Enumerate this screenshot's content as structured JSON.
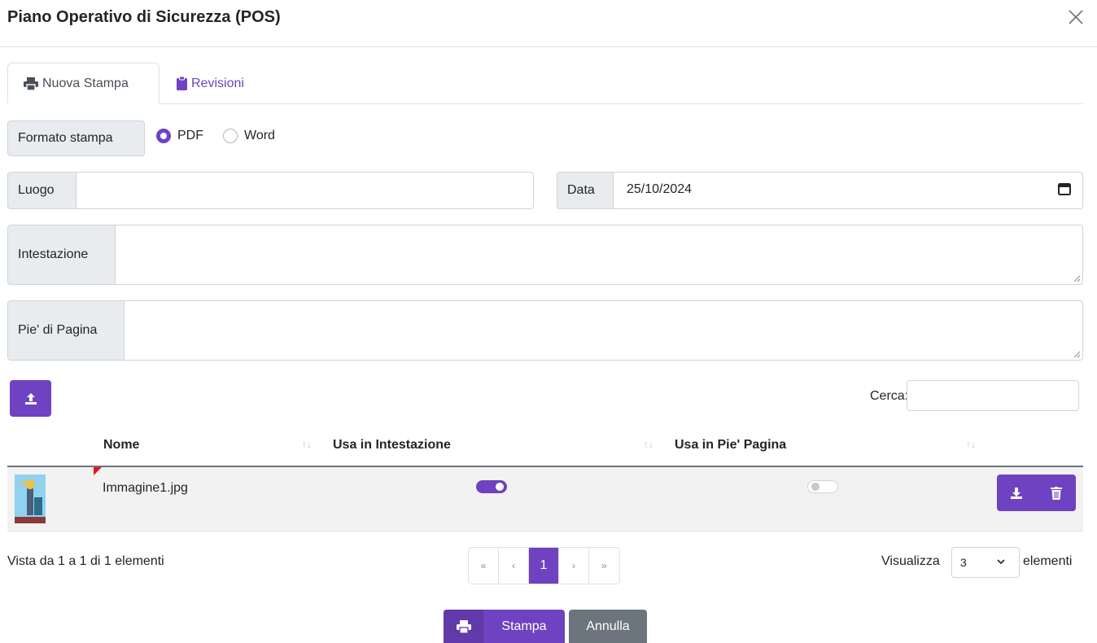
{
  "modal": {
    "title": "Piano Operativo di Sicurezza (POS)"
  },
  "tabs": [
    {
      "label": "Nuova Stampa",
      "icon": "print-icon",
      "active": true
    },
    {
      "label": "Revisioni",
      "icon": "clipboard-icon",
      "active": false
    }
  ],
  "form": {
    "format_label": "Formato stampa",
    "format_options": [
      {
        "label": "PDF",
        "checked": true
      },
      {
        "label": "Word",
        "checked": false
      }
    ],
    "place_label": "Luogo",
    "place_value": "",
    "date_label": "Data",
    "date_value": "25/10/2024",
    "header_label": "Intestazione",
    "header_value": "",
    "footer_label": "Pie' di Pagina",
    "footer_value": ""
  },
  "table": {
    "search_label": "Cerca:",
    "search_value": "",
    "columns": [
      "Nome",
      "Usa in Intestazione",
      "Usa in Pie' Pagina"
    ],
    "rows": [
      {
        "name": "Immagine1.jpg",
        "use_in_header": true,
        "use_in_footer": false
      }
    ],
    "info": "Vista da 1 a 1 di 1 elementi",
    "pagination": [
      "«",
      "‹",
      "1",
      "›",
      "»"
    ],
    "current_page": "1",
    "length_before": "Visualizza",
    "length_value": "3",
    "length_after": "elementi"
  },
  "footer": {
    "print_label": "Stampa",
    "cancel_label": "Annulla"
  },
  "colors": {
    "accent": "#6f42c1",
    "secondary": "#6c757d",
    "addon_bg": "#e9ecef",
    "row_bg": "#f2f2f2"
  }
}
